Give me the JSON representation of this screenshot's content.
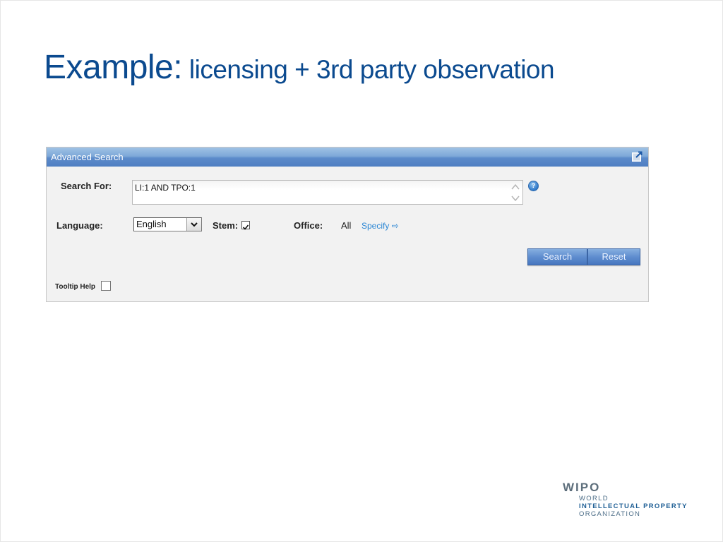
{
  "slide": {
    "title_main": "Example:",
    "title_sub": " licensing + 3rd party observation"
  },
  "panel": {
    "title": "Advanced Search",
    "icons": {
      "popout": "popout-window-icon",
      "help": "help-question-icon"
    },
    "search_for": {
      "label": "Search For:",
      "value": "LI:1 AND TPO:1",
      "help_glyph": "?"
    },
    "language": {
      "label": "Language:",
      "selected": "English"
    },
    "stem": {
      "label": "Stem:",
      "checked": true
    },
    "office": {
      "label": "Office:",
      "value": "All",
      "specify_link": "Specify ⇨"
    },
    "buttons": {
      "search": "Search",
      "reset": "Reset"
    },
    "tooltip_help": {
      "label": "Tooltip Help",
      "checked": false
    }
  },
  "logo": {
    "name": "WIPO",
    "line1": "WORLD",
    "line2": "INTELLECTUAL PROPERTY",
    "line3": "ORGANIZATION"
  }
}
